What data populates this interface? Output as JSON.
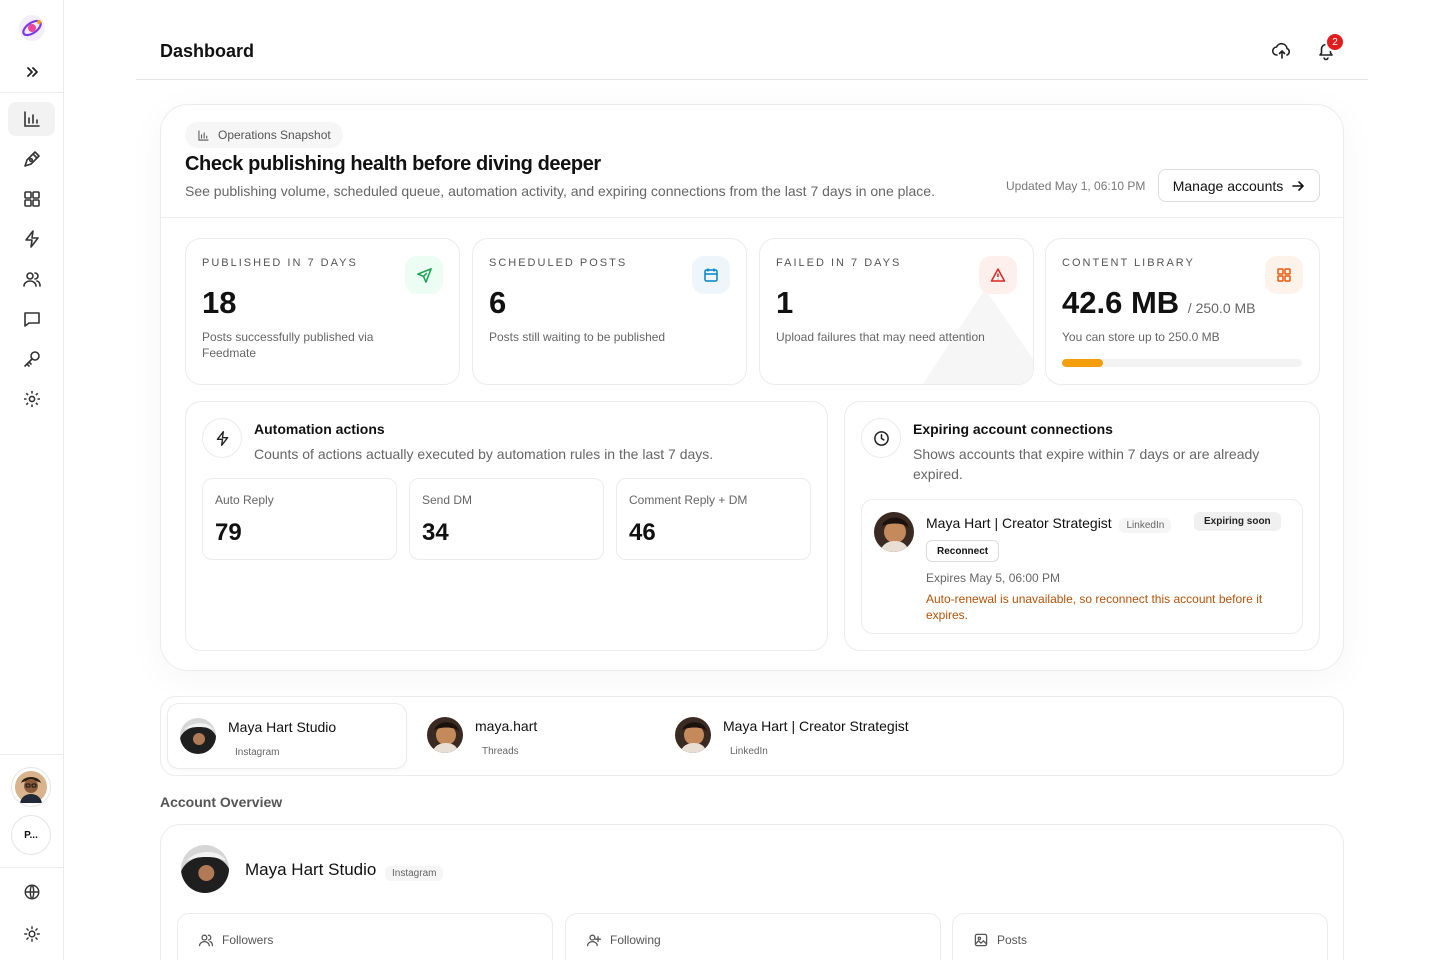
{
  "header": {
    "title": "Dashboard",
    "notification_count": "2"
  },
  "sidebar": {
    "workspace_initial": "P...",
    "items": [
      {
        "icon": "chart-icon",
        "active": true
      },
      {
        "icon": "pen-icon"
      },
      {
        "icon": "grid-icon"
      },
      {
        "icon": "bolt-icon"
      },
      {
        "icon": "users-icon"
      },
      {
        "icon": "message-icon"
      },
      {
        "icon": "key-icon"
      },
      {
        "icon": "gear-icon"
      }
    ]
  },
  "snapshot": {
    "pill": "Operations Snapshot",
    "heading": "Check publishing health before diving deeper",
    "subtitle": "See publishing volume, scheduled queue, automation activity, and expiring connections from the last 7 days in one place.",
    "updated": "Updated May 1, 06:10 PM",
    "manage_label": "Manage accounts",
    "stats": [
      {
        "label": "Published in 7 days",
        "value": "18",
        "desc": "Posts successfully published via Feedmate",
        "icon": "send-icon",
        "color": "#16a34a",
        "bg": "#ecfdf3"
      },
      {
        "label": "Scheduled posts",
        "value": "6",
        "desc": "Posts still waiting to be published",
        "icon": "calendar-icon",
        "color": "#0284c7",
        "bg": "#eef6fb"
      },
      {
        "label": "Failed in 7 days",
        "value": "1",
        "desc": "Upload failures that may need attention",
        "icon": "alert-icon",
        "color": "#dc2626",
        "bg": "#fdf0ec"
      },
      {
        "label": "Content library",
        "value": "42.6 MB",
        "suffix": "/ 250.0 MB",
        "desc": "You can store up to 250.0 MB",
        "icon": "grid-icon",
        "color": "#ea580c",
        "bg": "#fdf3ea",
        "progress": 0.17
      }
    ]
  },
  "automation": {
    "title": "Automation actions",
    "desc": "Counts of actions actually executed by automation rules in the last 7 days.",
    "actions": [
      {
        "label": "Auto Reply",
        "value": "79"
      },
      {
        "label": "Send DM",
        "value": "34"
      },
      {
        "label": "Comment Reply + DM",
        "value": "46"
      }
    ]
  },
  "expiring": {
    "title": "Expiring account connections",
    "desc_line1": "Shows accounts that expire within 7 days or are already",
    "desc_line2": "expired.",
    "account": {
      "name": "Maya Hart | Creator Strategist",
      "platform": "LinkedIn",
      "status": "Expiring soon",
      "reconnect_label": "Reconnect",
      "expires": "Expires May 5, 06:00 PM",
      "warning": "Auto-renewal is unavailable, so reconnect this account before it expires."
    }
  },
  "accounts": [
    {
      "name": "Maya Hart Studio",
      "platform": "Instagram",
      "active": true
    },
    {
      "name": "maya.hart",
      "platform": "Threads"
    },
    {
      "name": "Maya Hart | Creator Strategist",
      "platform": "LinkedIn"
    }
  ],
  "overview": {
    "title": "Account Overview",
    "account_name": "Maya Hart Studio",
    "platform": "Instagram",
    "metrics": [
      {
        "label": "Followers",
        "icon": "users-icon"
      },
      {
        "label": "Following",
        "icon": "user-plus-icon"
      },
      {
        "label": "Posts",
        "icon": "image-icon"
      }
    ]
  }
}
